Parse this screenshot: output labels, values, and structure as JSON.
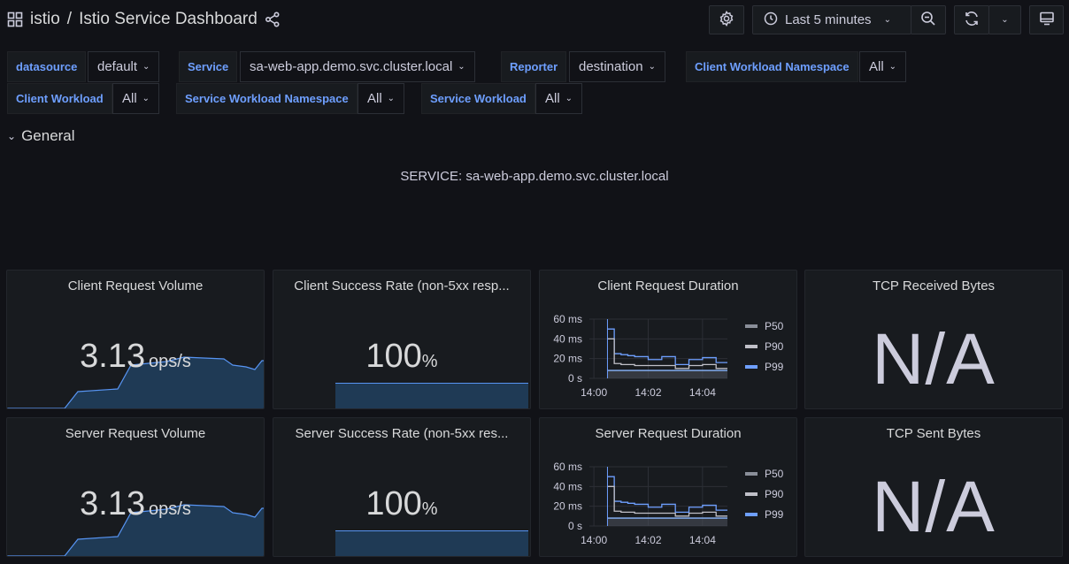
{
  "header": {
    "folder": "istio",
    "separator": "/",
    "dashboard_title": "Istio Service Dashboard",
    "time_range": "Last 5 minutes"
  },
  "variables": [
    {
      "label": "datasource",
      "value": "default"
    },
    {
      "label": "Service",
      "value": "sa-web-app.demo.svc.cluster.local"
    },
    {
      "label": "Reporter",
      "value": "destination"
    },
    {
      "label": "Client Workload Namespace",
      "value": "All"
    },
    {
      "label": "Client Workload",
      "value": "All"
    },
    {
      "label": "Service Workload Namespace",
      "value": "All"
    },
    {
      "label": "Service Workload",
      "value": "All"
    }
  ],
  "row": {
    "title": "General"
  },
  "service_text": "SERVICE: sa-web-app.demo.svc.cluster.local",
  "panels": {
    "client_volume": {
      "title": "Client Request Volume",
      "value": "3.13",
      "unit": "ops/s"
    },
    "client_success": {
      "title": "Client Success Rate (non-5xx resp...",
      "value": "100",
      "unit": "%"
    },
    "client_duration": {
      "title": "Client Request Duration"
    },
    "tcp_received": {
      "title": "TCP Received Bytes",
      "value": "N/A"
    },
    "server_volume": {
      "title": "Server Request Volume",
      "value": "3.13",
      "unit": "ops/s"
    },
    "server_success": {
      "title": "Server Success Rate (non-5xx res...",
      "value": "100",
      "unit": "%"
    },
    "server_duration": {
      "title": "Server Request Duration"
    },
    "tcp_sent": {
      "title": "TCP Sent Bytes",
      "value": "N/A"
    }
  },
  "chart_data": [
    {
      "type": "line",
      "title": "Client Request Duration",
      "y_ticks": [
        "60 ms",
        "40 ms",
        "20 ms",
        "0 s"
      ],
      "x_ticks": [
        "14:00",
        "14:02",
        "14:04"
      ],
      "ylim": [
        0,
        60
      ],
      "x": [
        "14:00:30",
        "14:00:45",
        "14:01:00",
        "14:01:15",
        "14:01:30",
        "14:02:00",
        "14:02:30",
        "14:03:00",
        "14:03:30",
        "14:04:00",
        "14:04:30"
      ],
      "series": [
        {
          "name": "P50",
          "values": [
            8,
            8,
            8,
            8,
            8,
            8,
            8,
            8,
            8,
            8,
            8
          ],
          "color": "#8ab8ff"
        },
        {
          "name": "P90",
          "values": [
            40,
            15,
            14,
            14,
            13,
            13,
            13,
            10,
            13,
            14,
            10
          ],
          "color": "#c0c0c8"
        },
        {
          "name": "P99",
          "values": [
            50,
            25,
            24,
            23,
            22,
            19,
            22,
            14,
            19,
            21,
            16
          ],
          "color": "#6e9fff"
        }
      ],
      "legend": "right"
    },
    {
      "type": "line",
      "title": "Server Request Duration",
      "y_ticks": [
        "60 ms",
        "40 ms",
        "20 ms",
        "0 s"
      ],
      "x_ticks": [
        "14:00",
        "14:02",
        "14:04"
      ],
      "ylim": [
        0,
        60
      ],
      "x": [
        "14:00:30",
        "14:00:45",
        "14:01:00",
        "14:01:15",
        "14:01:30",
        "14:02:00",
        "14:02:30",
        "14:03:00",
        "14:03:30",
        "14:04:00",
        "14:04:30"
      ],
      "series": [
        {
          "name": "P50",
          "values": [
            8,
            8,
            8,
            8,
            8,
            8,
            8,
            8,
            8,
            8,
            8
          ],
          "color": "#8ab8ff"
        },
        {
          "name": "P90",
          "values": [
            40,
            15,
            14,
            14,
            13,
            13,
            13,
            10,
            13,
            14,
            10
          ],
          "color": "#c0c0c8"
        },
        {
          "name": "P99",
          "values": [
            50,
            25,
            24,
            23,
            22,
            19,
            22,
            14,
            19,
            21,
            16
          ],
          "color": "#6e9fff"
        }
      ],
      "legend": "right"
    }
  ],
  "colors": {
    "accent": "#6e9fff",
    "sparkline_fill": "#1f3a55",
    "sparkline_line": "#5794f2"
  }
}
